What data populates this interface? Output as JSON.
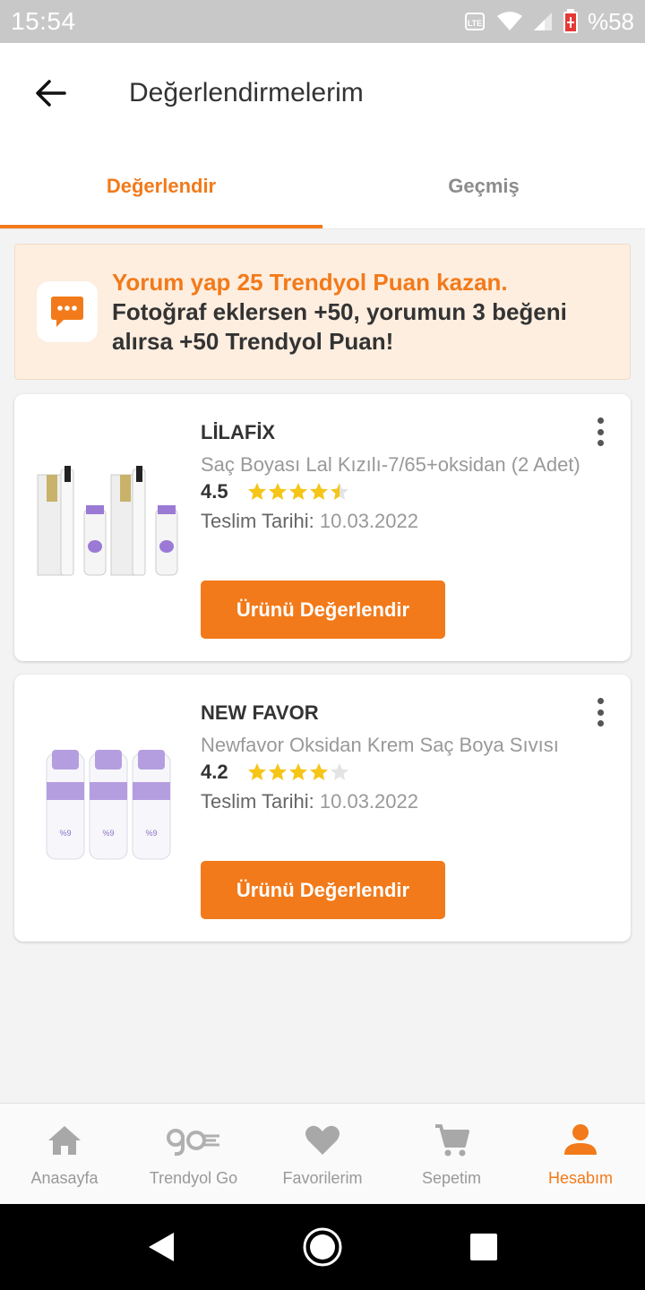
{
  "status_bar": {
    "time": "15:54",
    "battery": "%58"
  },
  "header": {
    "title": "Değerlendirmelerim"
  },
  "tabs": [
    {
      "label": "Değerlendir",
      "active": true
    },
    {
      "label": "Geçmiş",
      "active": false
    }
  ],
  "promo": {
    "highlight": "Yorum yap 25 Trendyol Puan kazan.",
    "line2": "Fotoğraf eklersen +50, yorumun 3 beğeni",
    "line3": "alırsa +50 Trendyol Puan!"
  },
  "products": [
    {
      "brand": "LİLAFİX",
      "name": "Saç Boyası Lal Kızılı-7/65+oksidan (2 Adet)",
      "rating": "4.5",
      "rating_value": 4.5,
      "delivery_label": "Teslim Tarihi:",
      "delivery_date": "10.03.2022",
      "button": "Ürünü Değerlendir"
    },
    {
      "brand": "NEW FAVOR",
      "name": "Newfavor Oksidan Krem Saç Boya Sıvısı",
      "rating": "4.2",
      "rating_value": 4.2,
      "delivery_label": "Teslim Tarihi:",
      "delivery_date": "10.03.2022",
      "button": "Ürünü Değerlendir"
    }
  ],
  "bottom_nav": [
    {
      "label": "Anasayfa",
      "icon": "home-icon",
      "active": false
    },
    {
      "label": "Trendyol Go",
      "icon": "trendyol-go-icon",
      "active": false
    },
    {
      "label": "Favorilerim",
      "icon": "heart-icon",
      "active": false
    },
    {
      "label": "Sepetim",
      "icon": "cart-icon",
      "active": false
    },
    {
      "label": "Hesabım",
      "icon": "account-icon",
      "active": true
    }
  ],
  "colors": {
    "accent": "#f27a1a",
    "promo_bg": "#fdeee0",
    "star": "#f5c518"
  }
}
